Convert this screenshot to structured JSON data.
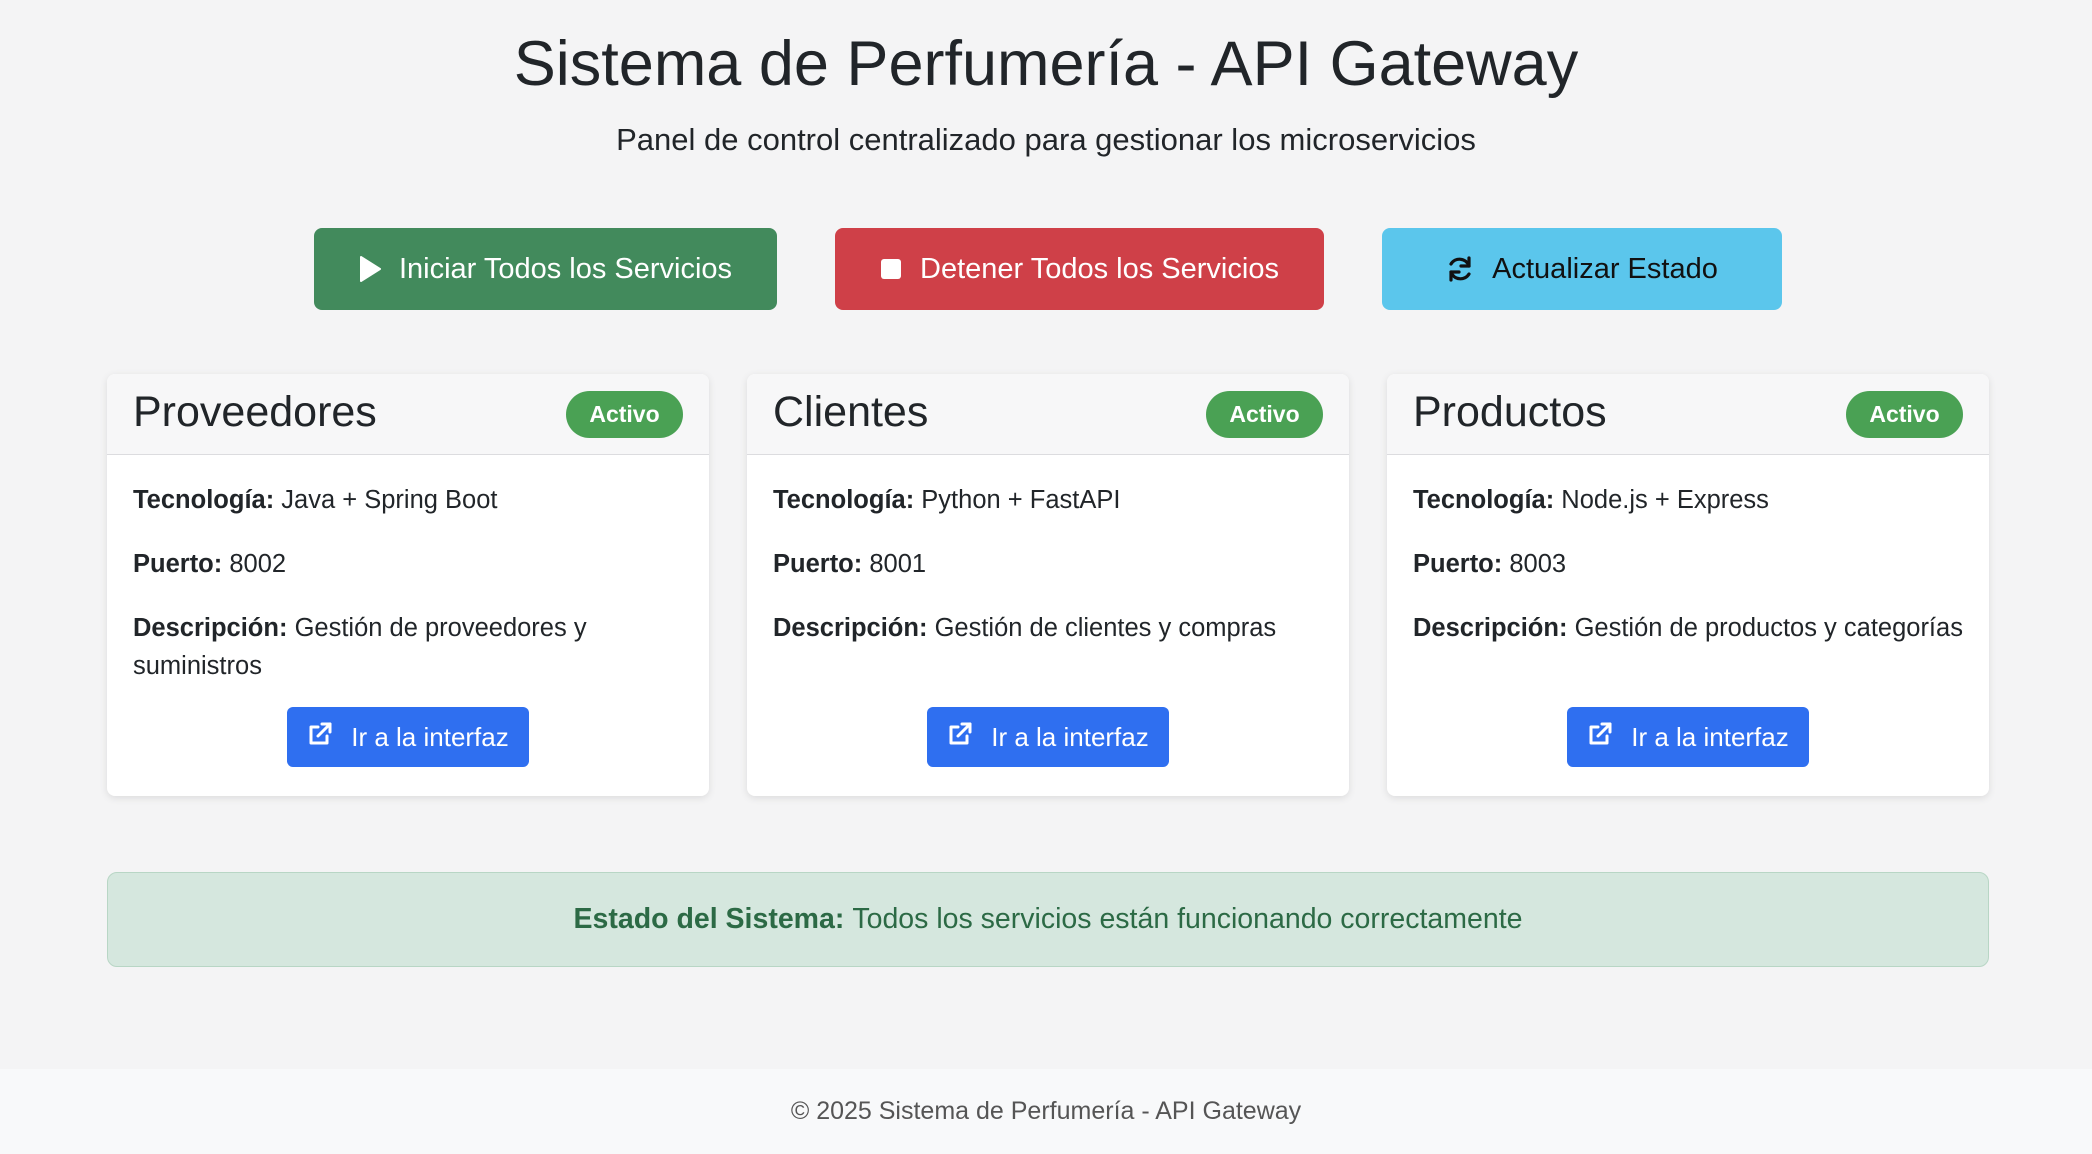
{
  "header": {
    "title": "Sistema de Perfumería - API Gateway",
    "subtitle": "Panel de control centralizado para gestionar los microservicios"
  },
  "actions": {
    "start_label": "Iniciar Todos los Servicios",
    "stop_label": "Detener Todos los Servicios",
    "refresh_label": "Actualizar Estado",
    "start_icon": "play-icon",
    "stop_icon": "stop-icon",
    "refresh_icon": "refresh-icon"
  },
  "labels": {
    "technology": "Tecnología:",
    "port": "Puerto:",
    "description": "Descripción:",
    "open_button": "Ir a la interfaz",
    "open_icon": "external-link-icon"
  },
  "services": [
    {
      "name": "Proveedores",
      "status": "Activo",
      "technology": "Java + Spring Boot",
      "port": "8002",
      "description": "Gestión de proveedores y suministros"
    },
    {
      "name": "Clientes",
      "status": "Activo",
      "technology": "Python + FastAPI",
      "port": "8001",
      "description": "Gestión de clientes y compras"
    },
    {
      "name": "Productos",
      "status": "Activo",
      "technology": "Node.js + Express",
      "port": "8003",
      "description": "Gestión de productos y categorías"
    }
  ],
  "system_status": {
    "label": "Estado del Sistema:",
    "message": "Todos los servicios están funcionando correctamente"
  },
  "footer": {
    "text": "© 2025 Sistema de Perfumería - API Gateway"
  },
  "colors": {
    "start_button": "#428a5c",
    "stop_button": "#cf4048",
    "refresh_button": "#5bc6ec",
    "active_badge": "#4aa154",
    "link_button": "#2f6ff0",
    "status_alert_bg": "#d5e7de",
    "status_alert_text": "#2c6a45"
  }
}
